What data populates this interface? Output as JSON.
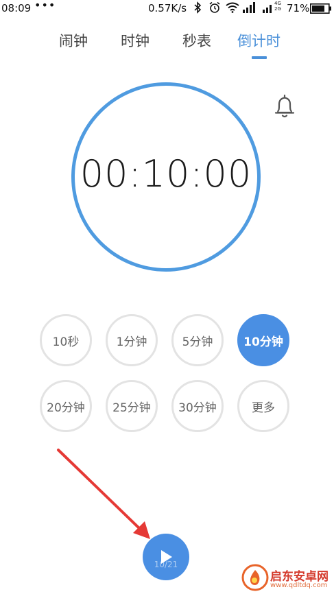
{
  "status_bar": {
    "time": "08:09",
    "dots": "•••",
    "speed": "0.57K/s",
    "network_type_top": "4G",
    "network_type_bottom": "2G",
    "battery_percent": "71%",
    "icons": [
      "bluetooth-icon",
      "alarm-icon",
      "wifi-icon",
      "signal-icon",
      "signal-icon",
      "battery-icon"
    ]
  },
  "tabs": [
    {
      "label": "闹钟",
      "active": false
    },
    {
      "label": "时钟",
      "active": false
    },
    {
      "label": "秒表",
      "active": false
    },
    {
      "label": "倒计时",
      "active": true
    }
  ],
  "timer": {
    "display": "00:10:00"
  },
  "presets": [
    {
      "label": "10秒",
      "selected": false
    },
    {
      "label": "1分钟",
      "selected": false
    },
    {
      "label": "5分钟",
      "selected": false
    },
    {
      "label": "10分钟",
      "selected": true
    },
    {
      "label": "20分钟",
      "selected": false
    },
    {
      "label": "25分钟",
      "selected": false
    },
    {
      "label": "30分钟",
      "selected": false
    },
    {
      "label": "更多",
      "selected": false
    }
  ],
  "controls": {
    "play_icon": "play-icon",
    "page_indicator": "10/21"
  },
  "watermark": {
    "title": "启东安卓网",
    "url": "www.qdltdq.com"
  },
  "colors": {
    "accent": "#4a90d9",
    "dial_ring": "#4f9be0",
    "preset_border": "#e3e3e3",
    "arrow": "#e53935"
  }
}
